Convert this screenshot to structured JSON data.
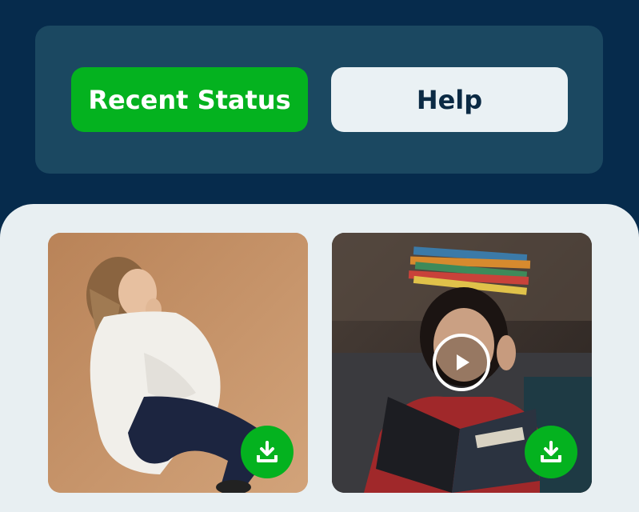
{
  "tabs": {
    "recent_status": "Recent Status",
    "help": "Help"
  },
  "statuses": [
    {
      "type": "image",
      "icon": "download-icon"
    },
    {
      "type": "video",
      "icon": "download-icon",
      "overlay_icon": "play-icon"
    }
  ],
  "colors": {
    "background": "#062b4c",
    "card": "#1b4861",
    "accent": "#04b21f",
    "panel": "#e8eff2"
  }
}
